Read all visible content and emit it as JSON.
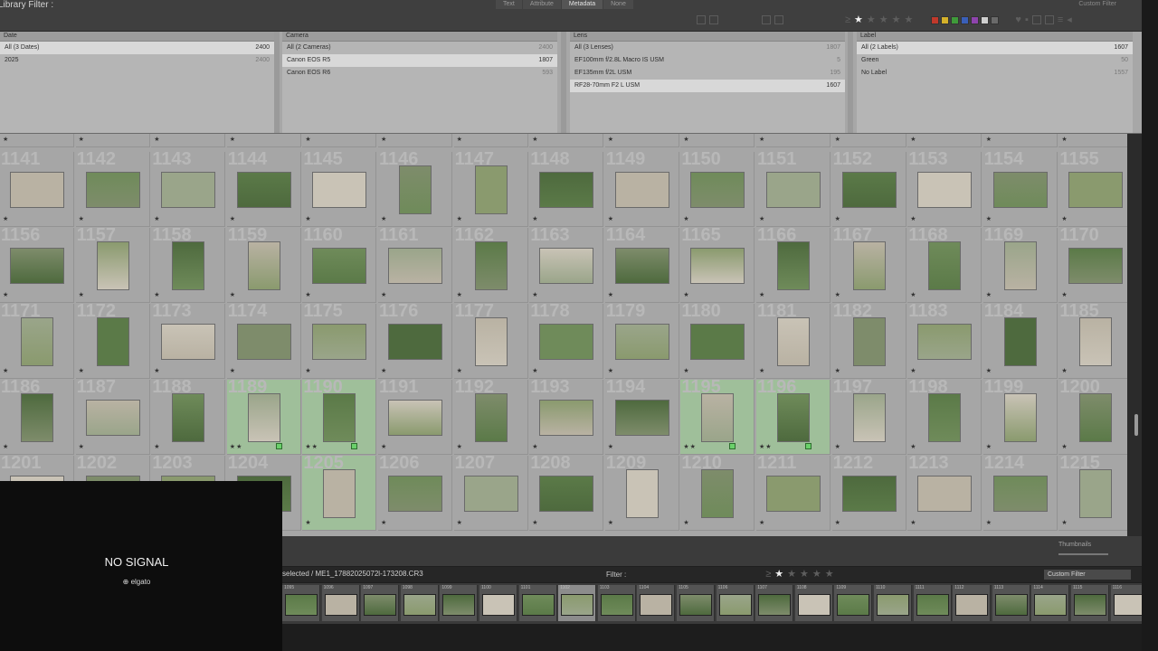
{
  "filter_bar": {
    "title": "Library Filter :",
    "tabs": [
      "Text",
      "Attribute",
      "Metadata",
      "None"
    ],
    "active_tab": "Metadata",
    "preset": "Custom Filter",
    "colors": [
      "#c0392b",
      "#d4b12a",
      "#3f9a3a",
      "#3a5fb8",
      "#8e44ad",
      "#cfcfcf",
      "#6a6a6a"
    ]
  },
  "metadata": {
    "columns": [
      {
        "header": "Date",
        "rows": [
          {
            "label": "All (3 Dates)",
            "count": "2400",
            "selected": true
          },
          {
            "label": "2025",
            "count": "2400",
            "selected": false
          }
        ]
      },
      {
        "header": "Camera",
        "rows": [
          {
            "label": "All (2 Cameras)",
            "count": "2400",
            "selected": false
          },
          {
            "label": "Canon EOS R5",
            "count": "1807",
            "selected": true
          },
          {
            "label": "Canon EOS R6",
            "count": "593",
            "selected": false
          }
        ]
      },
      {
        "header": "Lens",
        "rows": [
          {
            "label": "All (3 Lenses)",
            "count": "1807",
            "selected": false
          },
          {
            "label": "EF100mm f/2.8L Macro IS USM",
            "count": "5",
            "selected": false
          },
          {
            "label": "EF135mm f/2L USM",
            "count": "195",
            "selected": false
          },
          {
            "label": "RF28-70mm F2 L USM",
            "count": "1607",
            "selected": true
          }
        ]
      },
      {
        "header": "Label",
        "rows": [
          {
            "label": "All (2 Labels)",
            "count": "1607",
            "selected": true
          },
          {
            "label": "Green",
            "count": "50",
            "selected": false
          },
          {
            "label": "No Label",
            "count": "1557",
            "selected": false
          }
        ]
      }
    ]
  },
  "grid": {
    "rows": [
      {
        "numbers": [
          "",
          "",
          "",
          "",
          "",
          "",
          "",
          "",
          "",
          "",
          "",
          "",
          "",
          "",
          ""
        ]
      },
      {
        "numbers": [
          "1141",
          "1142",
          "1143",
          "1144",
          "1145",
          "1146",
          "1147",
          "1148",
          "1149",
          "1150",
          "1151",
          "1152",
          "1153",
          "1154",
          "1155"
        ]
      },
      {
        "numbers": [
          "1156",
          "1157",
          "1158",
          "1159",
          "1160",
          "1161",
          "1162",
          "1163",
          "1164",
          "1165",
          "1166",
          "1167",
          "1168",
          "1169",
          "1170"
        ]
      },
      {
        "numbers": [
          "1171",
          "1172",
          "1173",
          "1174",
          "1175",
          "1176",
          "1177",
          "1178",
          "1179",
          "1180",
          "1181",
          "1182",
          "1183",
          "1184",
          "1185"
        ]
      },
      {
        "numbers": [
          "1186",
          "1187",
          "1188",
          "1189",
          "1190",
          "1191",
          "1192",
          "1193",
          "1194",
          "1195",
          "1196",
          "1197",
          "1198",
          "1199",
          "1200"
        ]
      },
      {
        "numbers": [
          "1201",
          "1202",
          "1203",
          "1204",
          "1205",
          "1206",
          "1207",
          "1208",
          "1209",
          "1210",
          "1211",
          "1212",
          "1213",
          "1214",
          "1215"
        ]
      }
    ],
    "green_cells": [
      [
        4,
        3
      ],
      [
        4,
        4
      ],
      [
        4,
        9
      ],
      [
        4,
        10
      ],
      [
        5,
        4
      ]
    ],
    "two_star_cells": [
      [
        4,
        3
      ],
      [
        4,
        4
      ],
      [
        4,
        9
      ],
      [
        4,
        10
      ]
    ]
  },
  "toolbar": {
    "thumbnails_label": "Thumbnails"
  },
  "filmstrip": {
    "path": "selected / ME1_17882025072l-173208.CR3",
    "filter_label": "Filter :",
    "custom_filter": "Custom Filter",
    "numbers": [
      "1095",
      "1096",
      "1097",
      "1098",
      "1099",
      "1100",
      "1101",
      "1102",
      "1103",
      "1104",
      "1105",
      "1106",
      "1107",
      "1108",
      "1109",
      "1110",
      "1111",
      "1112",
      "1113",
      "1114",
      "1115",
      "1116"
    ]
  },
  "no_signal": {
    "text": "NO SIGNAL",
    "brand": "elgato"
  }
}
